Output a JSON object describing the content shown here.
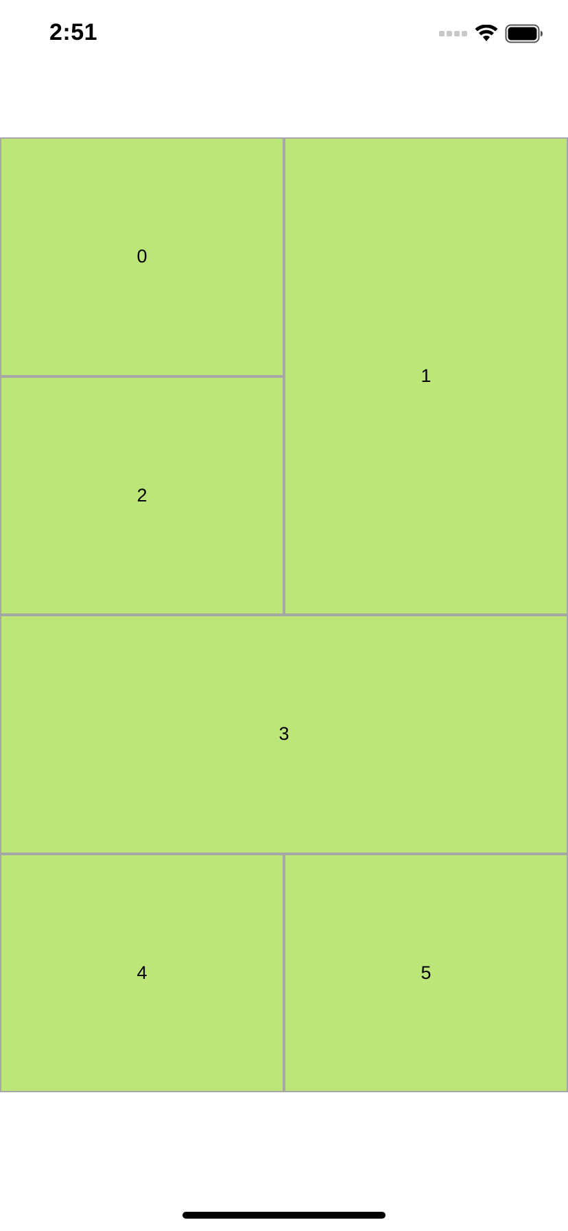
{
  "status_bar": {
    "time": "2:51",
    "icons": [
      "cellular-signal-icon",
      "wifi-icon",
      "battery-icon"
    ]
  },
  "grid": {
    "cells": [
      {
        "label": "0"
      },
      {
        "label": "1"
      },
      {
        "label": "2"
      },
      {
        "label": "3"
      },
      {
        "label": "4"
      },
      {
        "label": "5"
      }
    ]
  },
  "colors": {
    "cell_fill": "#bde679",
    "cell_border": "#a6a6a6",
    "background": "#ffffff",
    "text": "#000000"
  }
}
